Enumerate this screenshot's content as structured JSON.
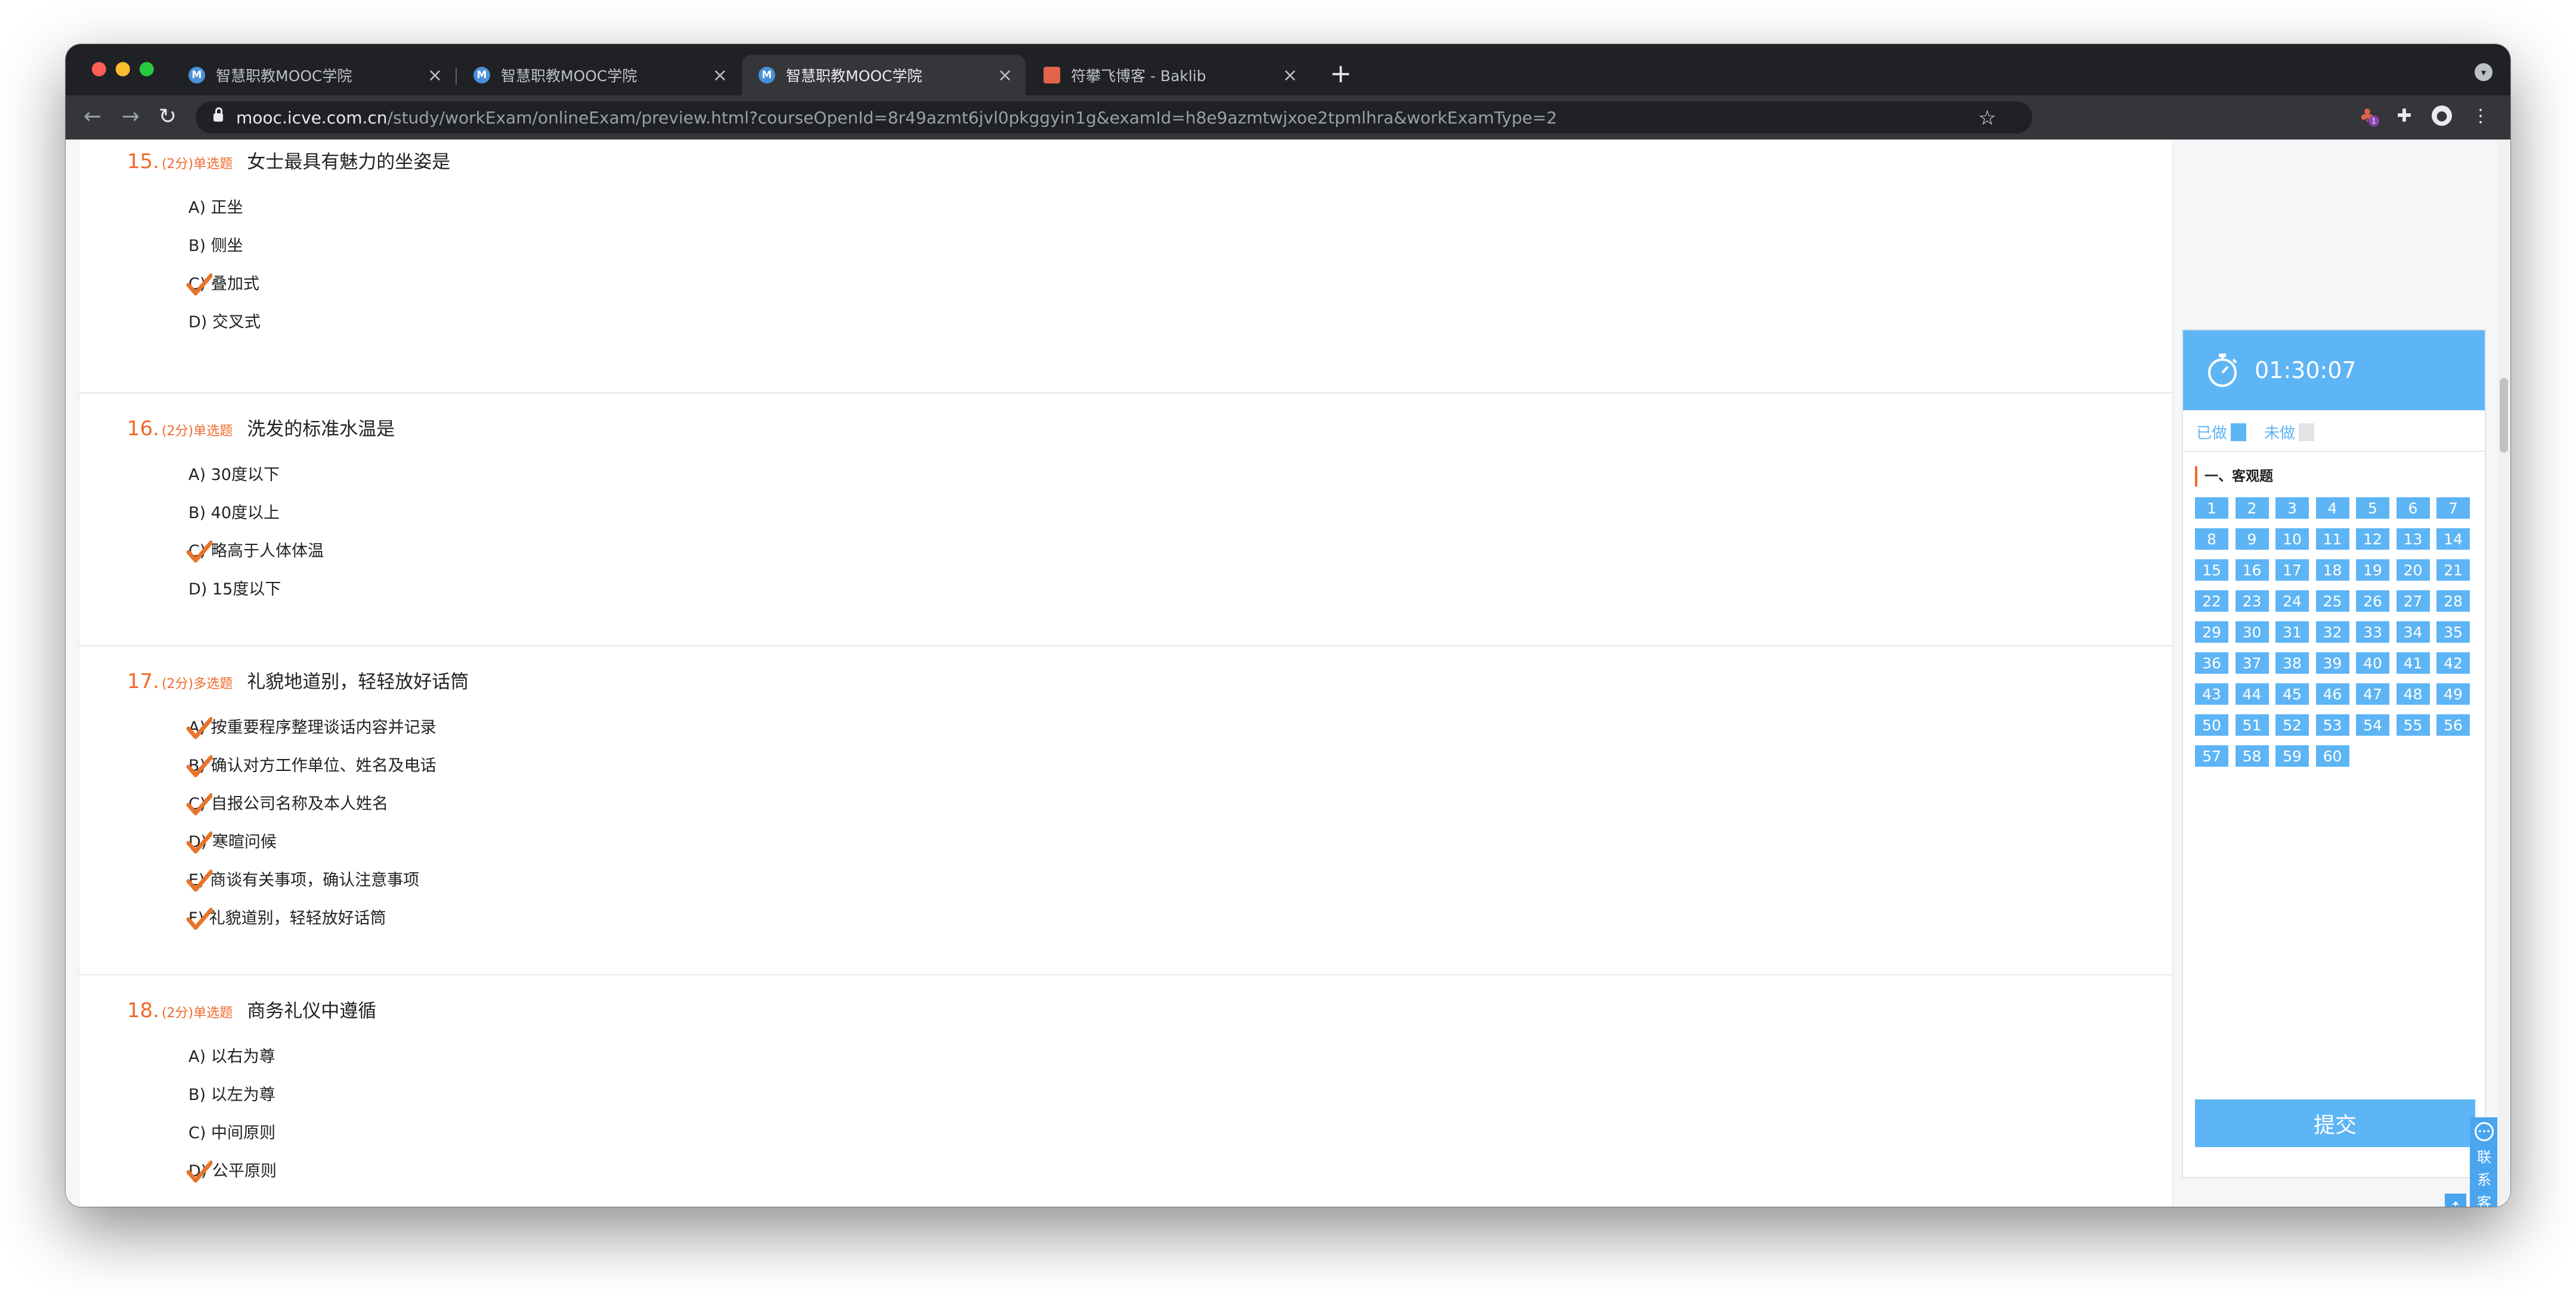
{
  "browser": {
    "tabs": [
      {
        "title": "智慧职教MOOC学院",
        "favicon": "mooc-icon"
      },
      {
        "title": "智慧职教MOOC学院",
        "favicon": "mooc-icon"
      },
      {
        "title": "智慧职教MOOC学院",
        "favicon": "mooc-icon",
        "active": true
      },
      {
        "title": "符攀飞博客 - Baklib",
        "favicon": "baklib-icon"
      }
    ],
    "tab_favicon_letter": "M",
    "tab_close": "×",
    "new_tab": "+",
    "url_host": "mooc.icve.com.cn",
    "url_path": "/study/workExam/onlineExam/preview.html?courseOpenId=8r49azmt6jvl0pkggyin1g&examId=h8e9azmtwjxoe2tpmlhra&workExamType=2",
    "extension_badge": "1"
  },
  "questions": [
    {
      "number": "15.",
      "meta": "(2分)单选题",
      "text": "女士最具有魅力的坐姿是",
      "options": [
        {
          "label": "A) 正坐",
          "checked": false
        },
        {
          "label": "B) 侧坐",
          "checked": false
        },
        {
          "label": "C) 叠加式",
          "checked": true
        },
        {
          "label": "D) 交叉式",
          "checked": false
        }
      ]
    },
    {
      "number": "16.",
      "meta": "(2分)单选题",
      "text": "洗发的标准水温是",
      "options": [
        {
          "label": "A) 30度以下",
          "checked": false
        },
        {
          "label": "B) 40度以上",
          "checked": false
        },
        {
          "label": "C) 略高于人体体温",
          "checked": true
        },
        {
          "label": "D) 15度以下",
          "checked": false
        }
      ]
    },
    {
      "number": "17.",
      "meta": "(2分)多选题",
      "text": "礼貌地道别，轻轻放好话筒",
      "options": [
        {
          "label": "A) 按重要程序整理谈话内容并记录",
          "checked": true
        },
        {
          "label": "B) 确认对方工作单位、姓名及电话",
          "checked": true
        },
        {
          "label": "C) 自报公司名称及本人姓名",
          "checked": true
        },
        {
          "label": "D) 寒暄问候",
          "checked": true
        },
        {
          "label": "E) 商谈有关事项，确认注意事项",
          "checked": true
        },
        {
          "label": "F) 礼貌道别，轻轻放好话筒",
          "checked": true
        }
      ]
    },
    {
      "number": "18.",
      "meta": "(2分)单选题",
      "text": "商务礼仪中遵循",
      "options": [
        {
          "label": "A) 以右为尊",
          "checked": false
        },
        {
          "label": "B) 以左为尊",
          "checked": false
        },
        {
          "label": "C) 中间原则",
          "checked": false
        },
        {
          "label": "D) 公平原则",
          "checked": true
        }
      ]
    }
  ],
  "answer_sheet": {
    "timer": "01:30:07",
    "legend_done": "已做",
    "legend_undone": "未做",
    "section_title": "一、客观题",
    "question_numbers": [
      "1",
      "2",
      "3",
      "4",
      "5",
      "6",
      "7",
      "8",
      "9",
      "10",
      "11",
      "12",
      "13",
      "14",
      "15",
      "16",
      "17",
      "18",
      "19",
      "20",
      "21",
      "22",
      "23",
      "24",
      "25",
      "26",
      "27",
      "28",
      "29",
      "30",
      "31",
      "32",
      "33",
      "34",
      "35",
      "36",
      "37",
      "38",
      "39",
      "40",
      "41",
      "42",
      "43",
      "44",
      "45",
      "46",
      "47",
      "48",
      "49",
      "50",
      "51",
      "52",
      "53",
      "54",
      "55",
      "56",
      "57",
      "58",
      "59",
      "60"
    ],
    "submit_label": "提交"
  },
  "customer_service": {
    "label": "联系客服"
  },
  "colors": {
    "accent": "#5eb5f5",
    "question_orange": "#f06a2c",
    "check_orange": "#e8742a"
  }
}
